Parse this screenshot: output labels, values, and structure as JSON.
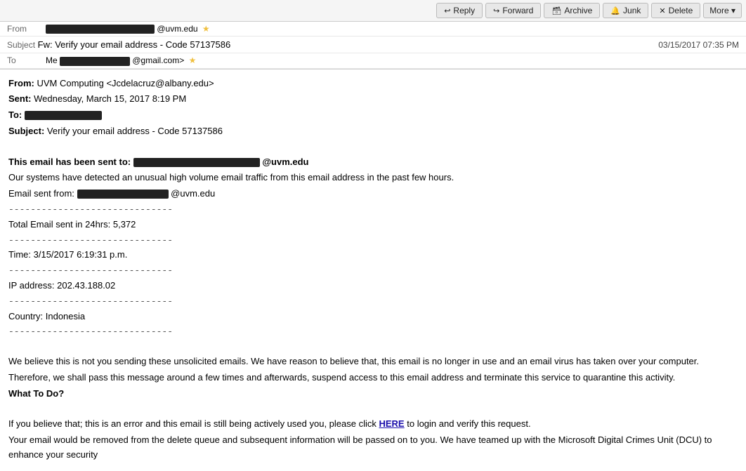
{
  "toolbar": {
    "reply_label": "Reply",
    "forward_label": "Forward",
    "archive_label": "Archive",
    "junk_label": "Junk",
    "delete_label": "Delete",
    "more_label": "More ▾"
  },
  "header": {
    "from_label": "From",
    "from_name": "UVM Computing <Jcdelacruz@albany.edu>",
    "from_email_display": "@uvm.edu",
    "star": "★",
    "subject_label": "Subject",
    "subject_text": "Fw: Verify your email address - Code 57137586",
    "to_label": "To",
    "to_display": "Me",
    "to_email_display": "@gmail.com>",
    "date": "03/15/2017 07:35 PM"
  },
  "body": {
    "from_line_label": "From:",
    "from_line_value": "UVM Computing <Jcdelacruz@albany.edu>",
    "sent_label": "Sent:",
    "sent_value": "Wednesday, March 15, 2017 8:19 PM",
    "to_label": "To:",
    "subject_label": "Subject:",
    "subject_value": "Verify your email address - Code 57137586",
    "intro_bold": "This email has been sent to:",
    "intro_email_suffix": "@uvm.edu",
    "body1": "Our systems have detected an unusual high volume email traffic from this email address in the past few hours.",
    "email_sent_label": "Email sent from:",
    "email_sent_suffix": "@uvm.edu",
    "divider1": "------------------------------",
    "total_label": "Total Email sent in 24hrs: 5,372",
    "divider2": "------------------------------",
    "time_label": "Time: 3/15/2017 6:19:31 p.m.",
    "divider3": "------------------------------",
    "ip_label": "IP address: 202.43.188.02",
    "divider4": "------------------------------",
    "country_label": "Country: Indonesia",
    "divider5": "------------------------------",
    "believe1": "We believe this is not you sending these unsolicited emails. We have reason to believe that, this email is no longer in use and an email virus has taken over your computer.",
    "therefore": "Therefore, we shall pass this message around a few times and afterwards, suspend access to this email address and terminate this service to quarantine this activity.",
    "what_to_do": "What To Do?",
    "if_believe_pre": "If you believe that; this is an error and this email is still being actively used you, please click ",
    "here_link": "HERE",
    "if_believe_post": " to login and verify this request.",
    "your_email": "Your email would be removed from the delete queue and subsequent information will be passed on to you. We have teamed up with the Microsoft Digital Crimes Unit (DCU) to enhance your security"
  }
}
